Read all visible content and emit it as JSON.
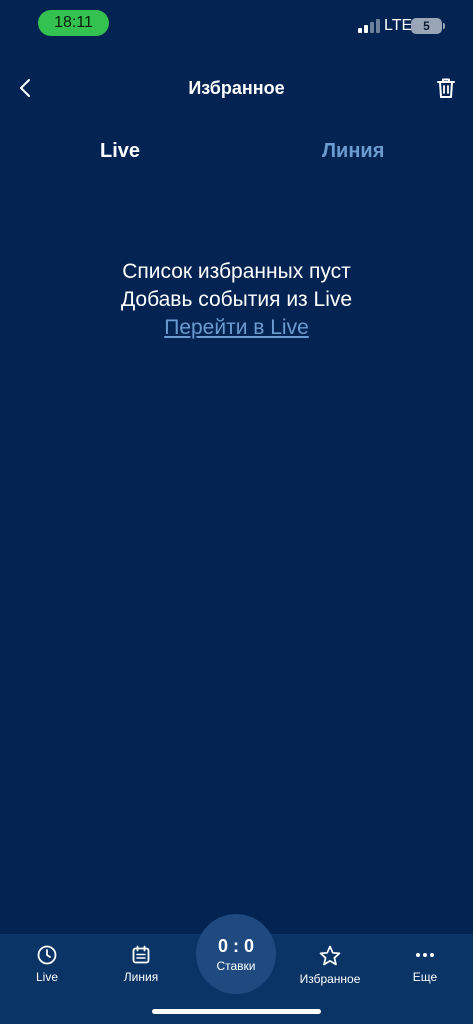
{
  "status_bar": {
    "time": "18:11",
    "network": "LTE",
    "battery": "5"
  },
  "header": {
    "title": "Избранное",
    "back_icon": "chevron-left-icon",
    "trash_icon": "trash-icon"
  },
  "tabs": [
    {
      "label": "Live",
      "active": true
    },
    {
      "label": "Линия",
      "active": false
    }
  ],
  "empty_state": {
    "line1": "Список избранных пуст",
    "line2": "Добавь события из Live",
    "link": "Перейти в Live"
  },
  "bottom_nav": {
    "items": [
      {
        "label": "Live",
        "icon": "clock-icon"
      },
      {
        "label": "Линия",
        "icon": "calendar-icon"
      },
      {
        "label": "Избранное",
        "icon": "star-icon"
      },
      {
        "label": "Еще",
        "icon": "more-dots-icon"
      }
    ],
    "bets": {
      "score": "0 : 0",
      "label": "Ставки"
    }
  },
  "colors": {
    "background": "#032453",
    "nav_background": "#0b3466",
    "accent_link": "#6c9bd0",
    "time_pill": "#33c24f"
  }
}
